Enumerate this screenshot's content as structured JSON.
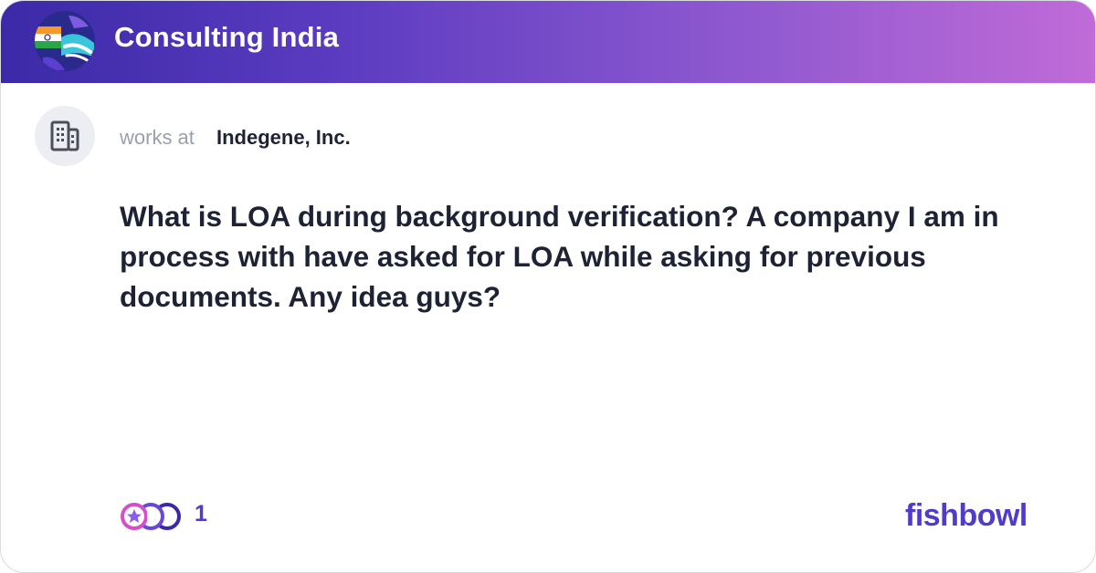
{
  "header": {
    "bowl_name": "Consulting India",
    "logo_icon": "india-flag-globe-icon",
    "gradient_start": "#3b2aa7",
    "gradient_end": "#c06bd8"
  },
  "author": {
    "avatar_icon": "office-building-icon",
    "works_at_label": "works at",
    "company": "Indegene, Inc."
  },
  "post": {
    "text": "What is LOA during background verification? A company I am in process with have asked for LOA while asking for previous documents. Any idea guys?"
  },
  "footer": {
    "reaction_icon": "reaction-faces-icon",
    "reaction_count": "1",
    "brand": "fishbowl",
    "brand_color": "#4f3cc9"
  }
}
